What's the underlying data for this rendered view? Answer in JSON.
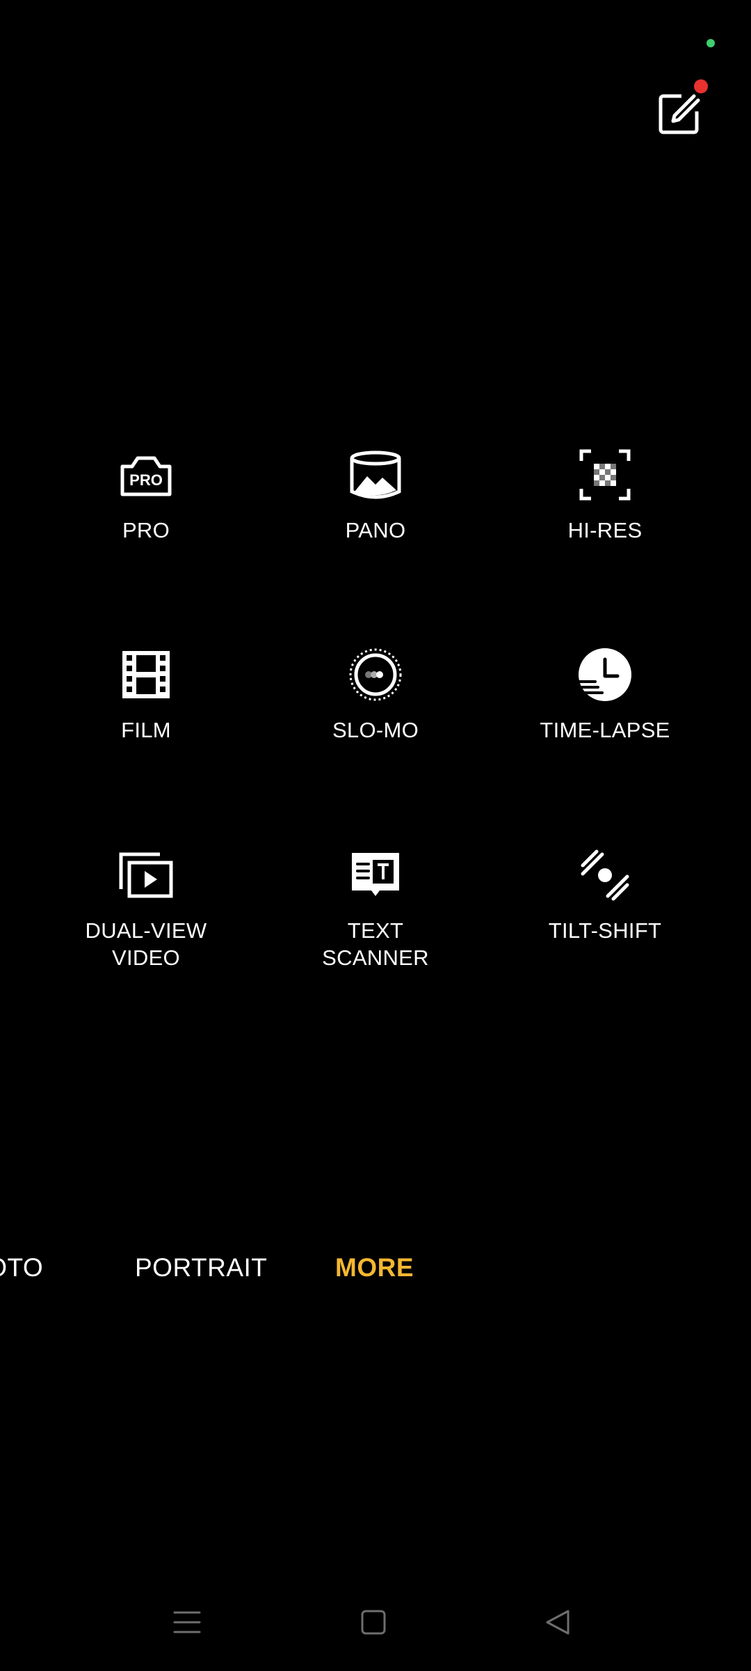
{
  "top": {
    "edit_icon": "edit-square-icon",
    "status_dot_color": "#3ecf6e",
    "badge_color": "#e8322f"
  },
  "modes": [
    {
      "label": "PRO",
      "icon": "pro-camera-icon"
    },
    {
      "label": "PANO",
      "icon": "panorama-icon"
    },
    {
      "label": "HI-RES",
      "icon": "hi-res-icon"
    },
    {
      "label": "FILM",
      "icon": "film-icon"
    },
    {
      "label": "SLO-MO",
      "icon": "slow-motion-icon"
    },
    {
      "label": "TIME-LAPSE",
      "icon": "time-lapse-icon"
    },
    {
      "label": "DUAL-VIEW\nVIDEO",
      "icon": "dual-view-video-icon"
    },
    {
      "label": "TEXT\nSCANNER",
      "icon": "text-scanner-icon"
    },
    {
      "label": "TILT-SHIFT",
      "icon": "tilt-shift-icon"
    }
  ],
  "mode_strip": {
    "photo": "HOTO",
    "portrait": "PORTRAIT",
    "more": "MORE",
    "active_color": "#f5b731"
  },
  "nav": {
    "menu_icon": "menu-icon",
    "home_icon": "home-square-icon",
    "back_icon": "back-triangle-icon"
  }
}
